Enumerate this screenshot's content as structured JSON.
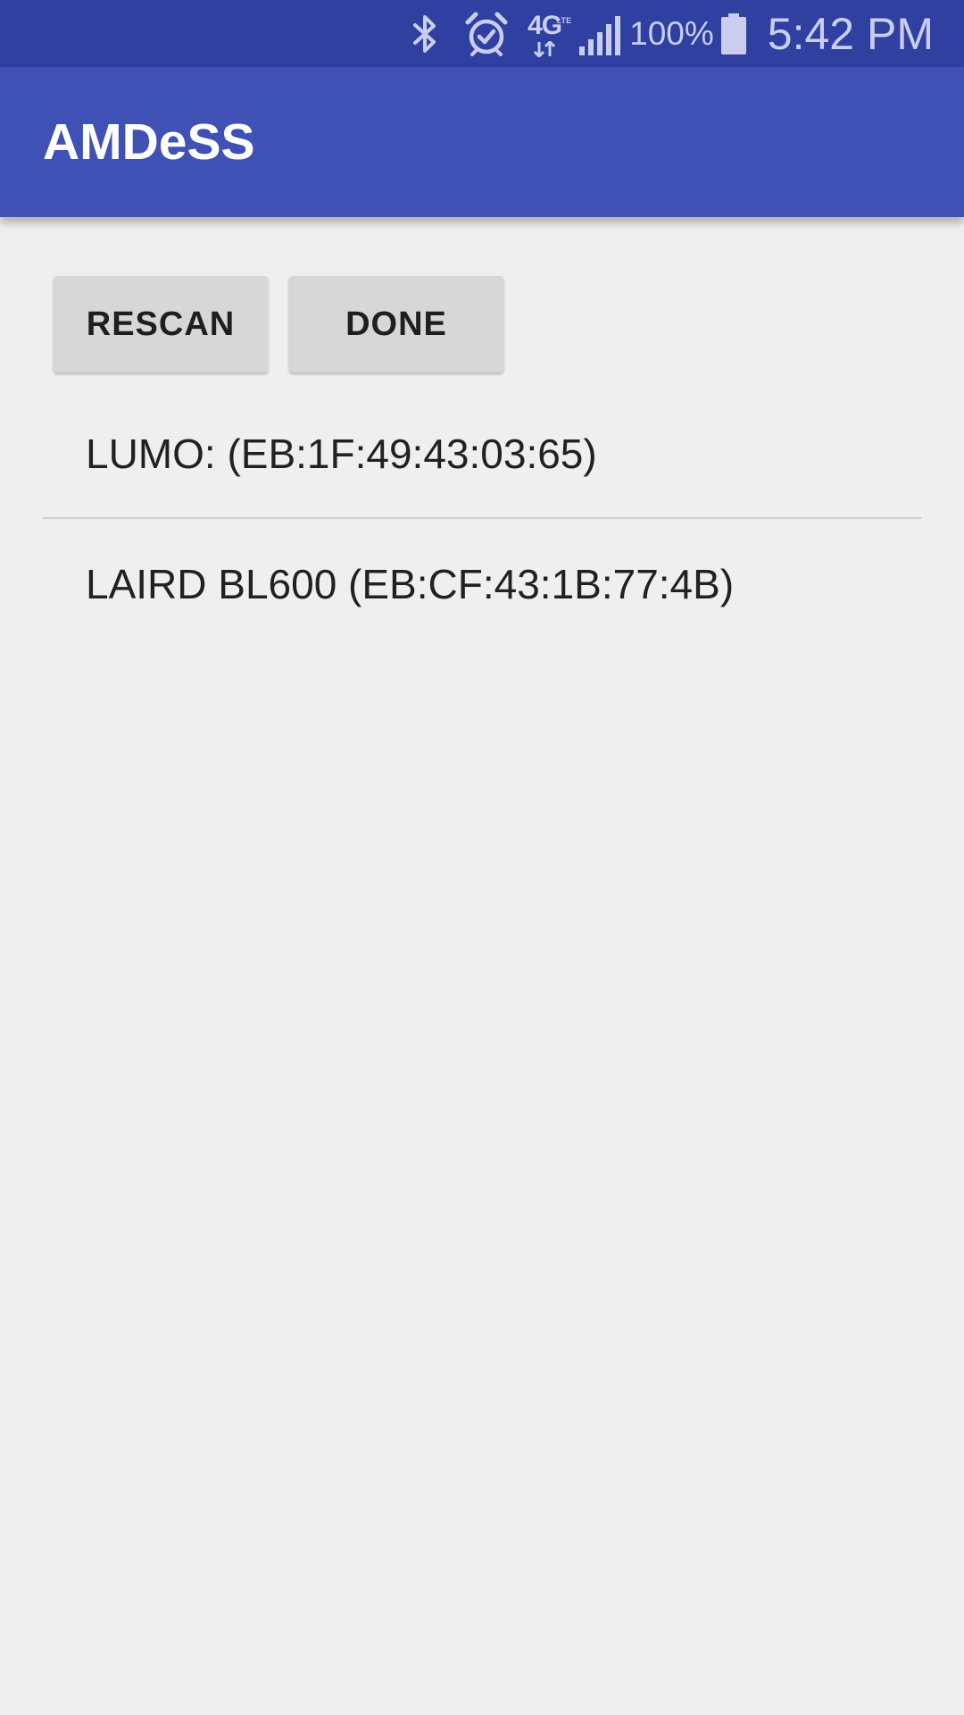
{
  "status_bar": {
    "icons": [
      "bluetooth-icon",
      "alarm-icon",
      "network-4g-lte-icon",
      "signal-icon",
      "battery-icon"
    ],
    "network_label": "4G",
    "network_sub": "LTE",
    "battery_text": "100%",
    "time": "5:42 PM",
    "color": "#3040a0"
  },
  "app_bar": {
    "title": "AMDeSS",
    "color": "#3f51b5"
  },
  "actions": {
    "rescan_label": "RESCAN",
    "done_label": "DONE"
  },
  "devices": [
    {
      "label": "LUMO: (EB:1F:49:43:03:65)"
    },
    {
      "label": "LAIRD BL600 (EB:CF:43:1B:77:4B)"
    }
  ]
}
